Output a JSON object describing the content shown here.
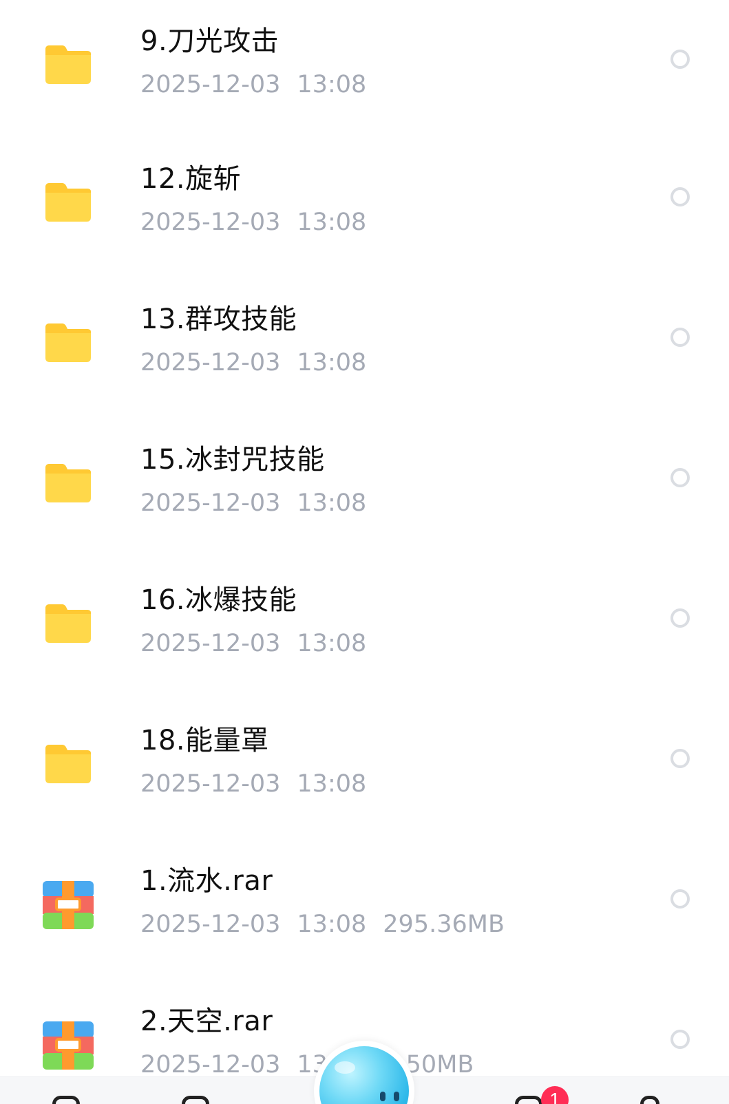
{
  "files": [
    {
      "name": "9.刀光攻击",
      "date": "2025-12-03",
      "time": "13:08",
      "size": "",
      "type": "folder"
    },
    {
      "name": "12.旋斩",
      "date": "2025-12-03",
      "time": "13:08",
      "size": "",
      "type": "folder"
    },
    {
      "name": "13.群攻技能",
      "date": "2025-12-03",
      "time": "13:08",
      "size": "",
      "type": "folder"
    },
    {
      "name": "15.冰封咒技能",
      "date": "2025-12-03",
      "time": "13:08",
      "size": "",
      "type": "folder"
    },
    {
      "name": "16.冰爆技能",
      "date": "2025-12-03",
      "time": "13:08",
      "size": "",
      "type": "folder"
    },
    {
      "name": "18.能量罩",
      "date": "2025-12-03",
      "time": "13:08",
      "size": "",
      "type": "folder"
    },
    {
      "name": "1.流水.rar",
      "date": "2025-12-03",
      "time": "13:08",
      "size": "295.36MB",
      "type": "archive"
    },
    {
      "name": "2.天空.rar",
      "date": "2025-12-03",
      "time": "13:08",
      "size": "...50MB",
      "type": "archive"
    }
  ],
  "tabbar": {
    "notification_count": "1"
  },
  "colors": {
    "folder": "#ffd84a",
    "folder_tab": "#ffc933",
    "meta_text": "#a5aab5",
    "badge": "#ff2d55"
  },
  "icons": {
    "folder": "folder-icon",
    "archive": "archive-icon",
    "assistant": "assistant-avatar-icon"
  }
}
